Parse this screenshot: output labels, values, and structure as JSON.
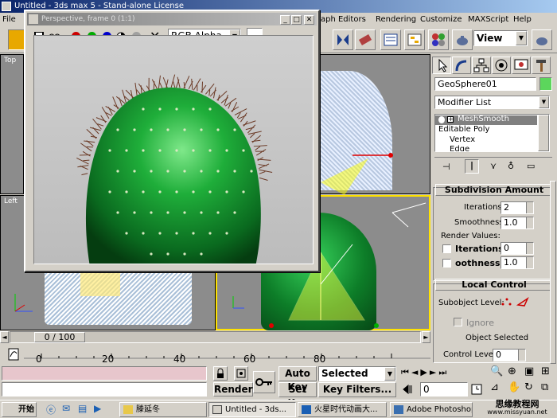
{
  "main_window": {
    "title": "Untitled - 3ds max 5 - Stand-alone License"
  },
  "menubar": {
    "file": "File",
    "graph_editors": "aph Editors",
    "rendering": "Rendering",
    "customize": "Customize",
    "maxscript": "MAXScript",
    "help": "Help"
  },
  "toolbar": {
    "view_dropdown": "View"
  },
  "viewports": {
    "top_label": "Top",
    "left_label": "Left"
  },
  "render_window": {
    "title": "Perspective, frame 0 (1:1)",
    "channel_dropdown": "RGB Alpha",
    "colors": {
      "red": "#cc0000",
      "green": "#00aa00",
      "blue": "#0000cc"
    }
  },
  "command_panel": {
    "object_name": "GeoSphere01",
    "object_color": "#5cd65c",
    "modifier_list_label": "Modifier List",
    "stack": [
      {
        "label": "MeshSmooth",
        "selected": true
      },
      {
        "label": "Editable Poly",
        "selected": false
      },
      {
        "label": "Vertex",
        "selected": false
      },
      {
        "label": "Edge",
        "selected": false
      }
    ],
    "subdivision_amount": {
      "header": "Subdivision Amount",
      "iterations_label": "Iterations:",
      "iterations_value": "2",
      "smoothness_label": "Smoothness:",
      "smoothness_value": "1.0",
      "render_values_label": "Render Values:",
      "render_iterations_label": "Iterations:",
      "render_iterations_value": "0",
      "render_smoothness_label": "oothness:",
      "render_smoothness_value": "1.0"
    },
    "local_control": {
      "header": "Local Control",
      "subobject_level_label": "Subobject Level:",
      "ignore_label": "Ignore",
      "object_selected_text": "Object Selected",
      "control_level_label": "Control Level:",
      "control_level_value": "0"
    }
  },
  "timeline": {
    "frame_display": "0 / 100",
    "ticks": [
      "0",
      "20",
      "40",
      "60",
      "80"
    ]
  },
  "status": {
    "auto_key_label": "Auto Key",
    "set_key_label": "Set Key",
    "selected_dropdown": "Selected",
    "key_filters_label": "Key Filters...",
    "render_label": "Render",
    "frame_field": "0"
  },
  "taskbar": {
    "start_label": "开始",
    "tasks": [
      {
        "label": "滕延冬"
      },
      {
        "label": "Untitled - 3ds..."
      },
      {
        "label": "火星时代动画大..."
      },
      {
        "label": "Adobe Photoshop"
      }
    ],
    "watermark_line1": "思缘教程网",
    "watermark_line2": "www.missyuan.net"
  }
}
